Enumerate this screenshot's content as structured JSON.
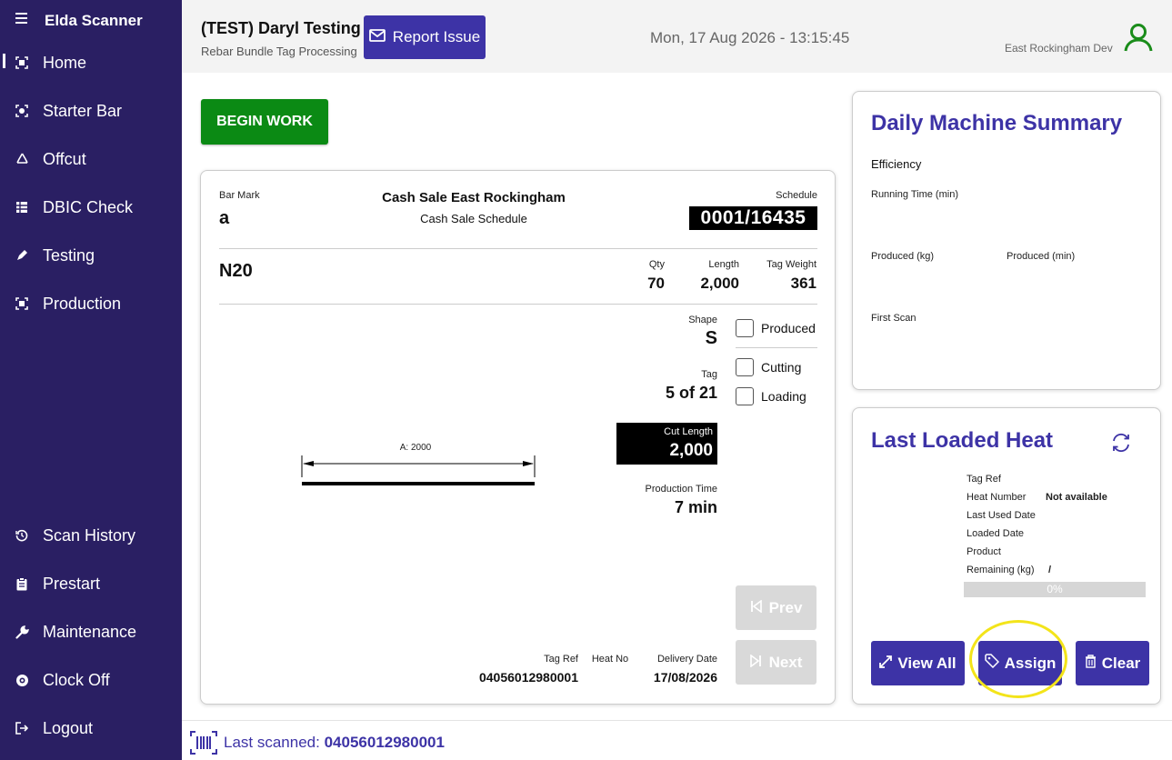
{
  "app": {
    "title": "Elda Scanner"
  },
  "sidebar": {
    "items": [
      {
        "label": "Home",
        "icon": "scan-icon"
      },
      {
        "label": "Starter Bar",
        "icon": "scan-icon"
      },
      {
        "label": "Offcut",
        "icon": "recycle-icon"
      },
      {
        "label": "DBIC Check",
        "icon": "grid-icon"
      },
      {
        "label": "Testing",
        "icon": "pen-icon"
      },
      {
        "label": "Production",
        "icon": "scan-icon"
      }
    ],
    "bottom_items": [
      {
        "label": "Scan History",
        "icon": "history-icon"
      },
      {
        "label": "Prestart",
        "icon": "clipboard-icon"
      },
      {
        "label": "Maintenance",
        "icon": "wrench-icon"
      },
      {
        "label": "Clock Off",
        "icon": "clock-icon"
      },
      {
        "label": "Logout",
        "icon": "logout-icon"
      }
    ]
  },
  "header": {
    "title": "(TEST) Daryl Testing",
    "subtitle": "Rebar Bundle Tag Processing",
    "report_label": "Report Issue",
    "datetime": "Mon, 17 Aug 2026 - 13:15:45",
    "site": "East Rockingham Dev"
  },
  "begin_label": "BEGIN WORK",
  "tag": {
    "bar_mark_label": "Bar Mark",
    "bar_mark": "a",
    "customer": "Cash Sale East Rockingham",
    "schedule_name": "Cash Sale Schedule",
    "schedule_label": "Schedule",
    "schedule": "0001/16435",
    "bar_type": "N20",
    "qty_label": "Qty",
    "qty": "70",
    "length_label": "Length",
    "length": "2,000",
    "weight_label": "Tag Weight",
    "weight": "361",
    "shape_label": "Shape",
    "shape": "S",
    "tag_label": "Tag",
    "tag": "5 of 21",
    "cut_length_label": "Cut Length",
    "cut_length": "2,000",
    "prod_time_label": "Production Time",
    "prod_time": "7 min",
    "dimension_label": "A: 2000",
    "produced_label": "Produced",
    "cutting_label": "Cutting",
    "loading_label": "Loading",
    "prev_label": "Prev",
    "next_label": "Next",
    "tag_ref_label": "Tag Ref",
    "tag_ref": "04056012980001",
    "heat_no_label": "Heat No",
    "delivery_label": "Delivery Date",
    "delivery": "17/08/2026"
  },
  "summary": {
    "title": "Daily Machine Summary",
    "efficiency": "Efficiency",
    "running_time": "Running Time (min)",
    "produced_kg": "Produced (kg)",
    "produced_min": "Produced (min)",
    "first_scan": "First Scan"
  },
  "heat": {
    "title": "Last Loaded Heat",
    "tag_ref_label": "Tag Ref",
    "heat_number_label": "Heat Number",
    "heat_number": "Not available",
    "last_used_label": "Last Used Date",
    "loaded_label": "Loaded Date",
    "product_label": "Product",
    "remaining_label": "Remaining (kg)",
    "remaining": "/",
    "progress_text": "0%",
    "progress_value": 0,
    "view_all_label": "View All",
    "assign_label": "Assign",
    "clear_label": "Clear"
  },
  "footer": {
    "last_scanned_label": "Last scanned:",
    "last_scanned": "04056012980001"
  },
  "colors": {
    "sidebar": "#2a1f63",
    "accent": "#3d33a6",
    "begin": "#0b8a14",
    "user_icon": "#1a8c1a",
    "highlight": "#f3e41a"
  }
}
